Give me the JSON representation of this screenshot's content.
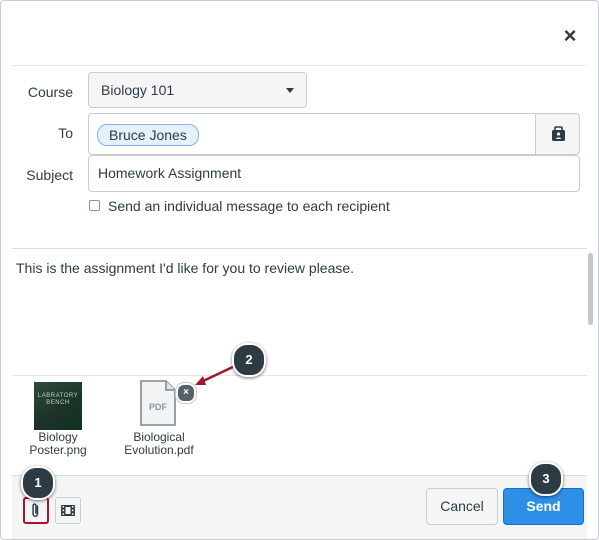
{
  "dialog": {
    "close_symbol": "×"
  },
  "form": {
    "course_label": "Course",
    "course_value": "Biology 101",
    "to_label": "To",
    "recipients": [
      "Bruce Jones"
    ],
    "subject_label": "Subject",
    "subject_value": "Homework Assignment",
    "individual_message_label": "Send an individual message to each recipient",
    "individual_message_checked": false
  },
  "message": {
    "body": "This is the assignment I'd like for you to review please."
  },
  "attachments": [
    {
      "name_line1": "Biology",
      "name_line2": "Poster.png",
      "thumbnail_text": "LABRATORY BENCH",
      "icon": "image-thumbnail"
    },
    {
      "name_line1": "Biological",
      "name_line2": "Evolution.pdf",
      "icon_text": "PDF",
      "icon": "pdf-file-icon"
    }
  ],
  "footer": {
    "attach_icon": "paperclip-icon",
    "media_icon": "media-icon",
    "cancel_label": "Cancel",
    "send_label": "Send"
  },
  "callouts": [
    "1",
    "2",
    "3"
  ],
  "colors": {
    "primary": "#2d8fe6",
    "text": "#2d3b45",
    "border": "#c7cdd1",
    "highlight": "#a0172e",
    "callout_arrow": "#a0172e"
  }
}
